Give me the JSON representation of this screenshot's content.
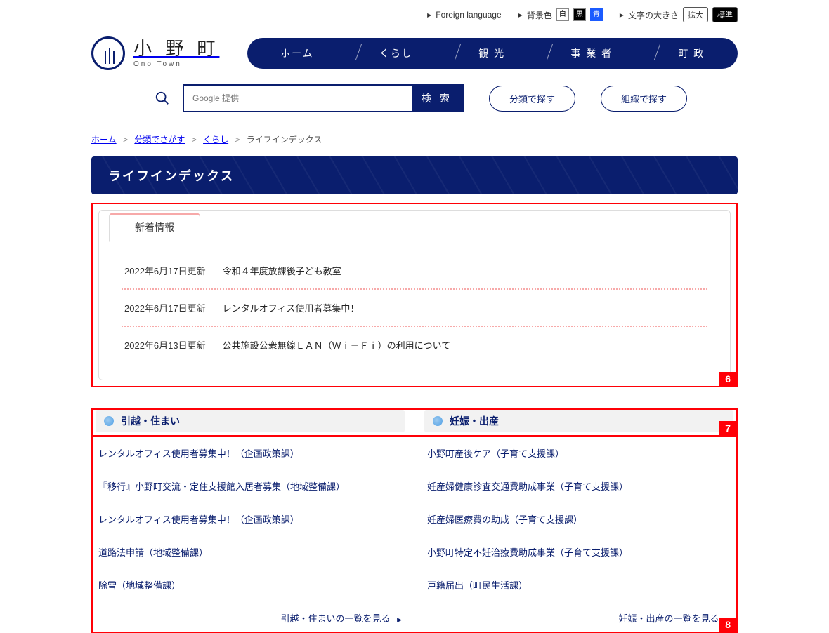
{
  "topbar": {
    "foreign_lang": "Foreign language",
    "bg_label": "背景色",
    "bg_white": "白",
    "bg_black": "黒",
    "bg_blue": "青",
    "text_size_label": "文字の大きさ",
    "text_large": "拡大",
    "text_normal": "標準"
  },
  "logo": {
    "jp": "小 野 町",
    "en": "Ono Town"
  },
  "nav": {
    "home": "ホーム",
    "living": "くらし",
    "tourism": "観 光",
    "business": "事 業 者",
    "gov": "町 政"
  },
  "search": {
    "placeholder": "Google 提供",
    "button": "検 索",
    "by_category": "分類で探す",
    "by_org": "組織で探す"
  },
  "breadcrumb": {
    "home": "ホーム",
    "by_cat": "分類でさがす",
    "living": "くらし",
    "current": "ライフインデックス"
  },
  "page_title": "ライフインデックス",
  "news": {
    "tab": "新着情報",
    "items": [
      {
        "date": "2022年6月17日更新",
        "title": "令和４年度放課後子ども教室"
      },
      {
        "date": "2022年6月17日更新",
        "title": "レンタルオフィス使用者募集中！"
      },
      {
        "date": "2022年6月13日更新",
        "title": "公共施設公衆無線ＬＡＮ（Ｗｉ－Ｆｉ）の利用について"
      }
    ]
  },
  "cat_left": {
    "title": "引越・住まい",
    "links": [
      "レンタルオフィス使用者募集中！（企画政策課）",
      "『移行』小野町交流・定住支援館入居者募集（地域整備課）",
      "レンタルオフィス使用者募集中！（企画政策課）",
      "道路法申請（地域整備課）",
      "除雪（地域整備課）"
    ],
    "more": "引越・住まいの一覧を見る"
  },
  "cat_right": {
    "title": "妊娠・出産",
    "links": [
      "小野町産後ケア（子育て支援課）",
      "妊産婦健康診査交通費助成事業（子育て支援課）",
      "妊産婦医療費の助成（子育て支援課）",
      "小野町特定不妊治療費助成事業（子育て支援課）",
      "戸籍届出（町民生活課）"
    ],
    "more": "妊娠・出産の一覧を見る"
  },
  "annot": {
    "a6": "6",
    "a7": "7",
    "a8": "8"
  }
}
